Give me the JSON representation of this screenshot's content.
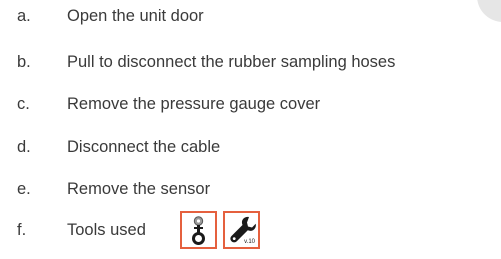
{
  "steps": [
    {
      "letter": "a.",
      "text": "Open the unit door"
    },
    {
      "letter": "b.",
      "text": "Pull to disconnect the rubber sampling hoses"
    },
    {
      "letter": "c.",
      "text": "Remove the pressure gauge cover"
    },
    {
      "letter": "d.",
      "text": "Disconnect the cable"
    },
    {
      "letter": "e.",
      "text": "Remove the sensor"
    },
    {
      "letter": "f.",
      "text": "Tools used"
    }
  ],
  "tools": {
    "icons": [
      "door-key-icon",
      "wrench-icon"
    ],
    "wrench_version": "v.10",
    "border_color": "#e5603e"
  }
}
